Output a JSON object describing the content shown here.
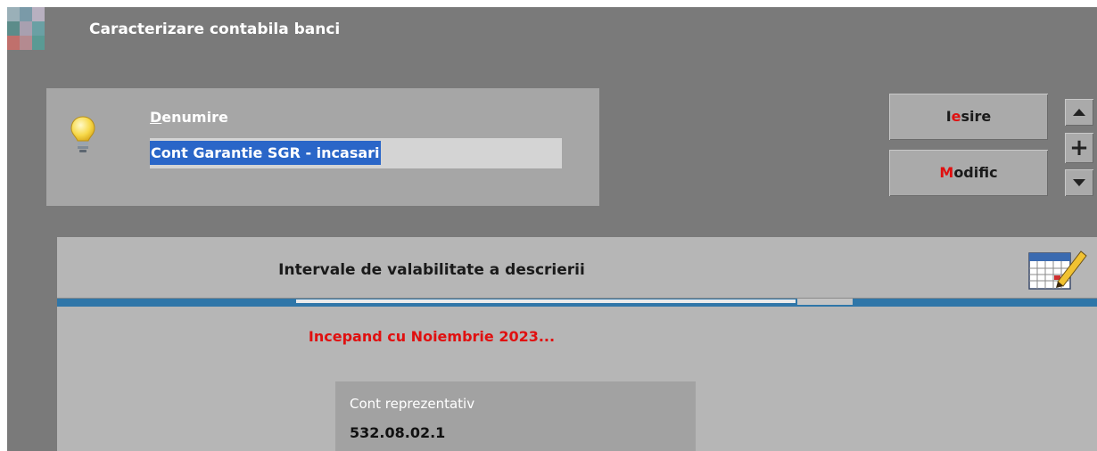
{
  "window": {
    "title": "Caracterizare contabila banci"
  },
  "name_field": {
    "label_hotkey": "D",
    "label_rest": "enumire",
    "value": "Cont Garantie SGR - incasari"
  },
  "buttons": {
    "exit": {
      "hotkey_pre": "I",
      "hotkey": "e",
      "rest": "sire"
    },
    "modify": {
      "hotkey": "M",
      "rest": "odific"
    }
  },
  "spinner": {
    "up_icon": "triangle-up",
    "plus": "+",
    "down_icon": "triangle-down"
  },
  "intervals": {
    "title": "Intervale de valabilitate a descrierii",
    "start_text": "Incepand cu Noiembrie 2023...",
    "account_label": "Cont reprezentativ",
    "account_value": "532.08.02.1"
  },
  "colors": {
    "background": "#7a7a7a",
    "panel": "#a6a6a6",
    "selection": "#2a66c8",
    "hotkey": "#e01010",
    "tab_strip": "#2f76a8"
  }
}
